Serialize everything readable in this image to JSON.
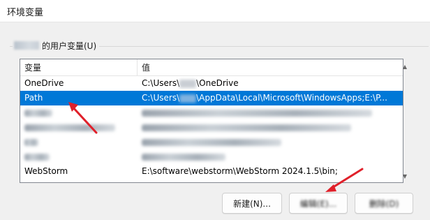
{
  "window": {
    "title": "环境变量"
  },
  "user_vars_group": {
    "label": "的用户变量(U)"
  },
  "table": {
    "headers": [
      "变量",
      "值"
    ],
    "rows": [
      {
        "name": "OneDrive",
        "value_prefix": "C:\\Users\\",
        "value_suffix": "\\OneDrive",
        "selected": false,
        "blurred": false
      },
      {
        "name": "Path",
        "value_prefix": "C:\\Users\\",
        "value_suffix": "\\AppData\\Local\\Microsoft\\WindowsApps;E:\\P...",
        "selected": true,
        "blurred": false
      },
      {
        "name": "",
        "value_prefix": "",
        "value_suffix": "",
        "selected": false,
        "blurred": true
      },
      {
        "name": "",
        "value_prefix": "",
        "value_suffix": "",
        "selected": false,
        "blurred": true
      },
      {
        "name": "",
        "value_prefix": "",
        "value_suffix": "",
        "selected": false,
        "blurred": true
      },
      {
        "name": "",
        "value_prefix": "",
        "value_suffix": "",
        "selected": false,
        "blurred": true
      },
      {
        "name": "WebStorm",
        "value_prefix": "E:\\software\\webstorm\\WebStorm 2024.1.5\\bin;",
        "value_suffix": "",
        "selected": false,
        "blurred": false
      }
    ]
  },
  "buttons": {
    "new_label": "新建(N)...",
    "edit_label": "编辑(E)...",
    "delete_label": "删除(D)"
  },
  "colors": {
    "selection": "#0078d7",
    "annotation_arrow": "#e0202a"
  }
}
